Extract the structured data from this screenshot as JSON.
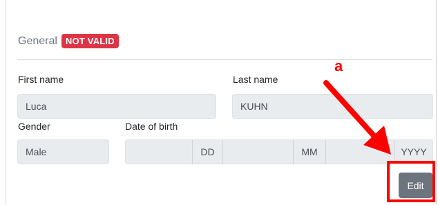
{
  "section": {
    "title": "General",
    "badge": "NOT VALID"
  },
  "fields": {
    "first_name": {
      "label": "First name",
      "value": "Luca"
    },
    "last_name": {
      "label": "Last name",
      "value": "KUHN"
    },
    "gender": {
      "label": "Gender",
      "value": "Male"
    },
    "date_of_birth": {
      "label": "Date of birth",
      "day_placeholder": "DD",
      "month_placeholder": "MM",
      "year_placeholder": "YYYY"
    }
  },
  "actions": {
    "edit_label": "Edit"
  },
  "annotation": {
    "marker": "a",
    "color": "#ff0000",
    "arrow_icon": "arrow-down-right-icon"
  },
  "colors": {
    "badge": "#dc3545",
    "button": "#6c757d",
    "field_bg": "#e9ecef"
  }
}
